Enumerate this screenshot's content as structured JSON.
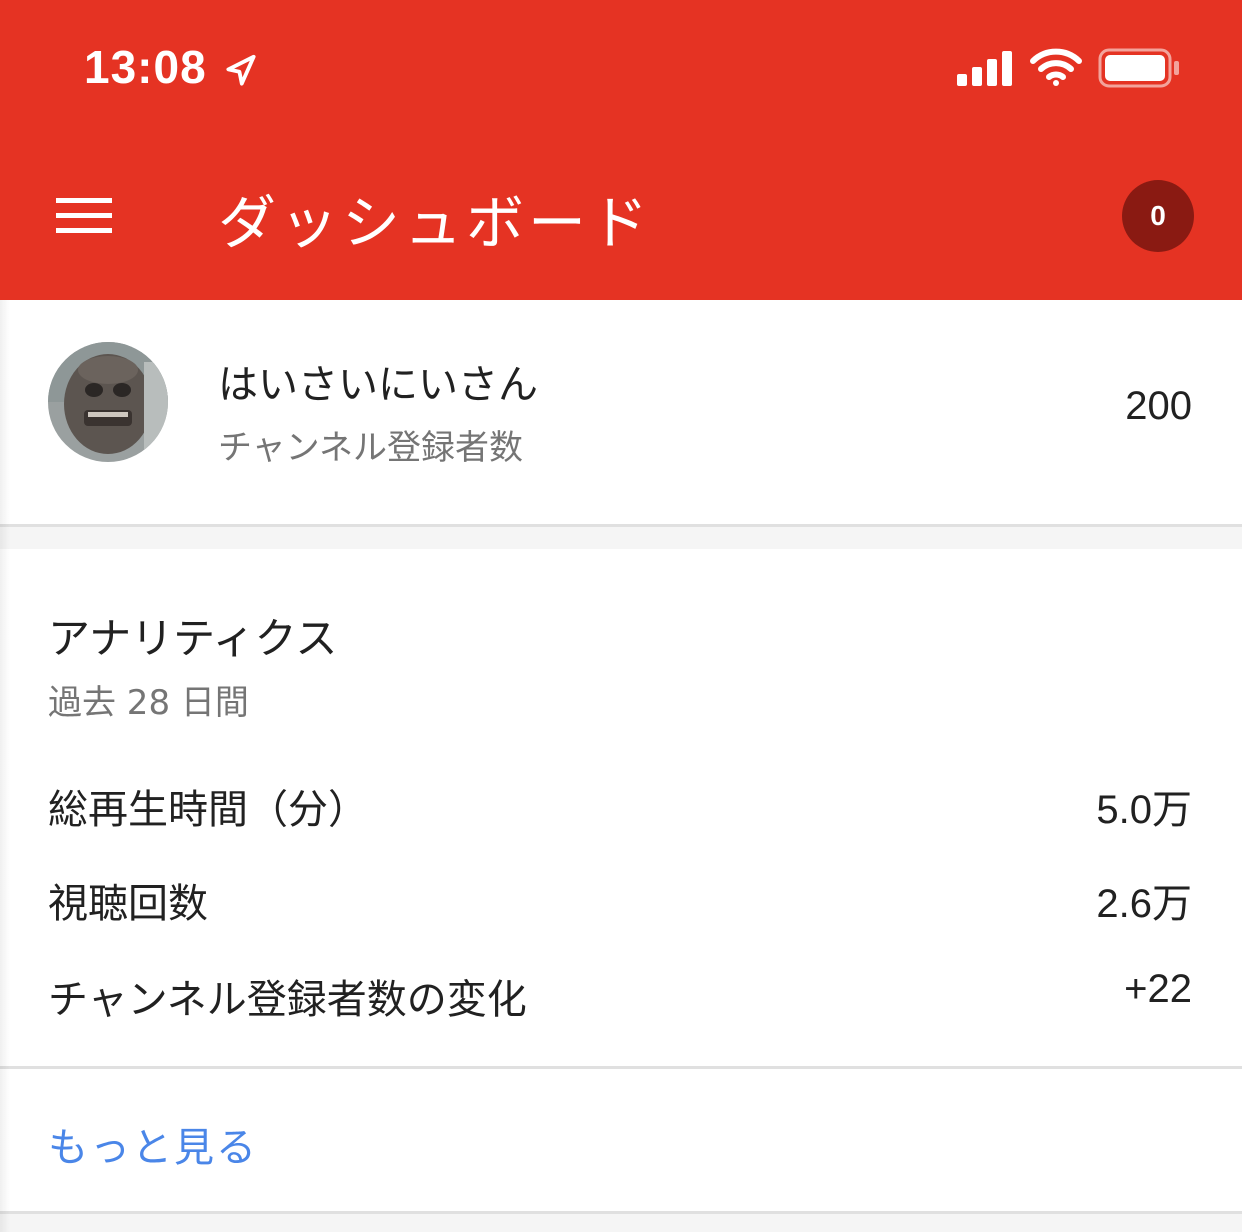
{
  "status_bar": {
    "time": "13:08",
    "icons": [
      "location-arrow-icon",
      "cellular-signal-icon",
      "wifi-icon",
      "battery-icon"
    ]
  },
  "app_bar": {
    "title": "ダッシュボード",
    "menu_icon": "hamburger-menu-icon",
    "notification_count": "0"
  },
  "channel": {
    "name": "はいさいにいさん",
    "subscribers_label": "チャンネル登録者数",
    "subscribers_count": "200"
  },
  "analytics": {
    "title": "アナリティクス",
    "period": "過去 28 日間",
    "rows": [
      {
        "label": "総再生時間（分）",
        "value": "5.0万"
      },
      {
        "label": "視聴回数",
        "value": "2.6万"
      },
      {
        "label": "チャンネル登録者数の変化",
        "value": "+22"
      }
    ]
  },
  "more_link": "もっと見る",
  "colors": {
    "header": "#e53323",
    "badge": "#8a1a12",
    "link": "#4a86e8"
  }
}
